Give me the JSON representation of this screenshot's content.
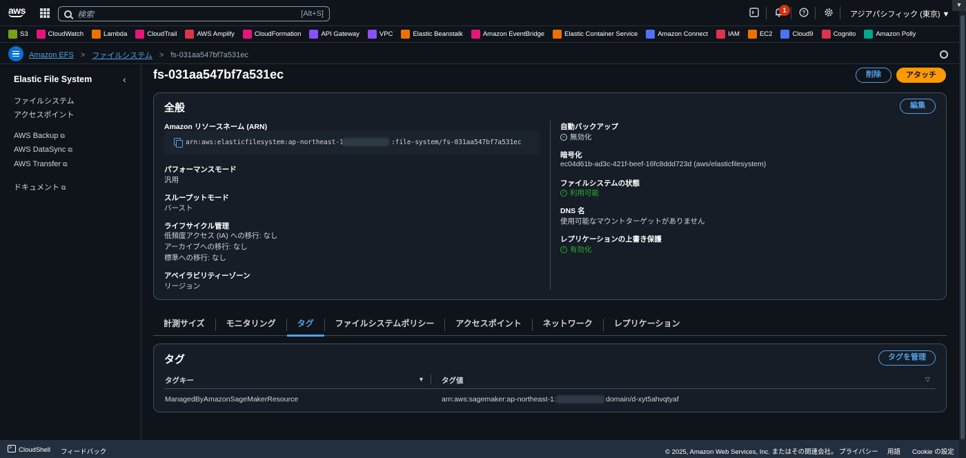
{
  "topnav": {
    "logo_text": "aws",
    "search_placeholder": "検索",
    "search_shortcut": "[Alt+S]",
    "notification_count": "1",
    "region": "アジアパシフィック (東京) ▼"
  },
  "favorites": [
    {
      "label": "S3",
      "color": "#7aa116"
    },
    {
      "label": "CloudWatch",
      "color": "#e7157b"
    },
    {
      "label": "Lambda",
      "color": "#ed7100"
    },
    {
      "label": "CloudTrail",
      "color": "#e7157b"
    },
    {
      "label": "AWS Amplify",
      "color": "#dd344c"
    },
    {
      "label": "CloudFormation",
      "color": "#e7157b"
    },
    {
      "label": "API Gateway",
      "color": "#8c4fff"
    },
    {
      "label": "VPC",
      "color": "#8c4fff"
    },
    {
      "label": "Elastic Beanstalk",
      "color": "#ed7100"
    },
    {
      "label": "Amazon EventBridge",
      "color": "#e7157b"
    },
    {
      "label": "Elastic Container Service",
      "color": "#ed7100"
    },
    {
      "label": "Amazon Connect",
      "color": "#4d72f3"
    },
    {
      "label": "IAM",
      "color": "#dd344c"
    },
    {
      "label": "EC2",
      "color": "#ed7100"
    },
    {
      "label": "Cloud9",
      "color": "#4d72f3"
    },
    {
      "label": "Cognito",
      "color": "#dd344c"
    },
    {
      "label": "Amazon Polly",
      "color": "#01a88d"
    }
  ],
  "breadcrumb": {
    "root": "Amazon EFS",
    "section": "ファイルシステム",
    "current": "fs-031aa547bf7a531ec"
  },
  "sidebar": {
    "title": "Elastic File System",
    "links": [
      "ファイルシステム",
      "アクセスポイント"
    ],
    "external_links": [
      "AWS Backup",
      "AWS DataSync",
      "AWS Transfer"
    ],
    "docs": "ドキュメント"
  },
  "page": {
    "title": "fs-031aa547bf7a531ec",
    "delete_button": "削除",
    "attach_button": "アタッチ"
  },
  "general": {
    "heading": "全般",
    "edit_button": "編集",
    "arn_label": "Amazon リソースネーム (ARN)",
    "arn_prefix": "arn:aws:elasticfilesystem:ap-northeast-1",
    "arn_suffix": ":file-system/fs-031aa547bf7a531ec",
    "performance_label": "パフォーマンスモード",
    "performance_value": "汎用",
    "throughput_label": "スループットモード",
    "throughput_value": "バースト",
    "lifecycle_label": "ライフサイクル管理",
    "lifecycle_ia": "低頻度アクセス (IA) への移行: なし",
    "lifecycle_archive": "アーカイブへの移行: なし",
    "lifecycle_standard": "標準への移行: なし",
    "az_label": "アベイラビリティーゾーン",
    "az_value": "リージョン",
    "backup_label": "自動バックアップ",
    "backup_value": "無効化",
    "encryption_label": "暗号化",
    "encryption_value": "ec04d61b-ad3c-421f-beef-16fc8ddd723d (aws/elasticfilesystem)",
    "state_label": "ファイルシステムの状態",
    "state_value": "利用可能",
    "dns_label": "DNS 名",
    "dns_value": "使用可能なマウントターゲットがありません",
    "replication_label": "レプリケーションの上書き保護",
    "replication_value": "有効化"
  },
  "tabs": [
    "計測サイズ",
    "モニタリング",
    "タグ",
    "ファイルシステムポリシー",
    "アクセスポイント",
    "ネットワーク",
    "レプリケーション"
  ],
  "active_tab": "タグ",
  "tags": {
    "heading": "タグ",
    "manage_button": "タグを管理",
    "columns": [
      "タグキー",
      "タグ値"
    ],
    "rows": [
      {
        "key": "ManagedByAmazonSageMakerResource",
        "value_prefix": "arn:aws:sagemaker:ap-northeast-1:",
        "value_suffix": "domain/d-xyt5ahvqtyaf"
      }
    ]
  },
  "footer": {
    "cloudshell": "CloudShell",
    "feedback": "フィードバック",
    "copyright": "© 2025, Amazon Web Services, Inc. またはその関連会社。",
    "privacy": "プライバシー",
    "terms": "用語",
    "cookie": "Cookie の設定"
  }
}
